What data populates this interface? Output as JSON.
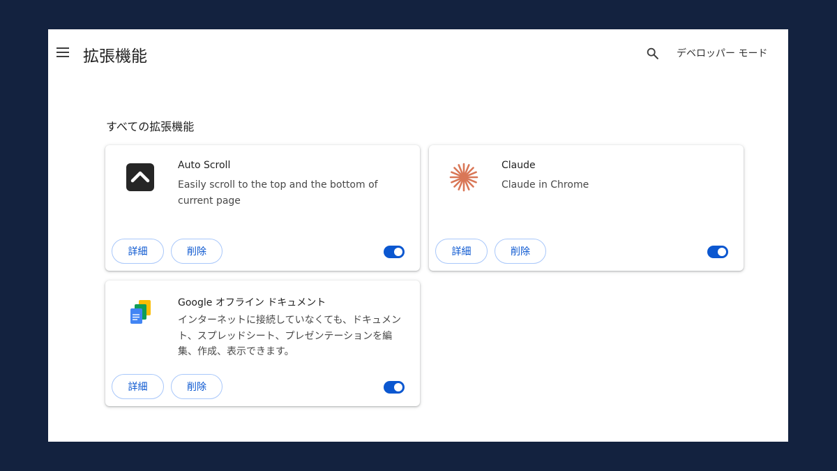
{
  "header": {
    "title": "拡張機能",
    "dev_mode_label": "デベロッパー モード"
  },
  "section": {
    "title": "すべての拡張機能"
  },
  "extensions": [
    {
      "name": "Auto Scroll",
      "description": "Easily scroll to the top and the bottom of current page",
      "icon": "chevron-up-icon",
      "enabled": true
    },
    {
      "name": "Claude",
      "description": "Claude in Chrome",
      "icon": "claude-sparkle-icon",
      "enabled": true
    },
    {
      "name": "Google オフライン ドキュメント",
      "description": "インターネットに接続していなくても、ドキュメント、スプレッドシート、プレゼンテーションを編集、作成、表示できます。",
      "icon": "google-docs-icon",
      "enabled": true
    }
  ],
  "buttons": {
    "details_label": "詳細",
    "remove_label": "削除"
  },
  "colors": {
    "accent": "#0b57d0",
    "claude": "#d97757",
    "backdrop": "#13223f"
  }
}
